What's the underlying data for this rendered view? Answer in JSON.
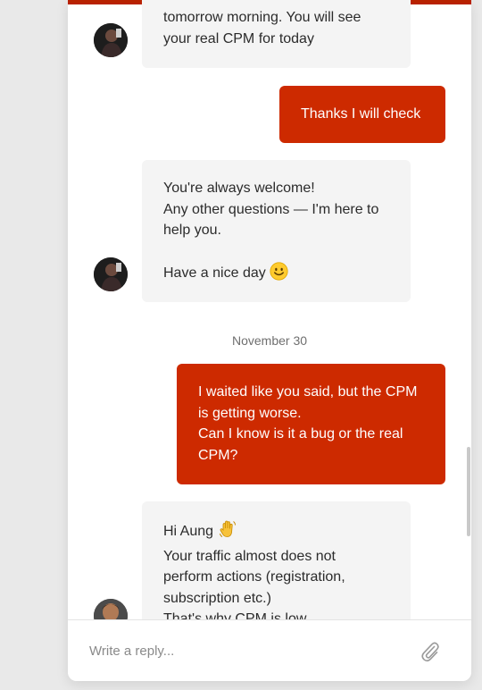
{
  "colors": {
    "accent": "#cd2a00",
    "incoming_bg": "#f4f4f4",
    "topbar": "#b82200"
  },
  "messages": [
    {
      "lines": [
        "tomorrow morning. You will see",
        "your real CPM for today"
      ]
    },
    {
      "lines": [
        "Thanks I will check"
      ]
    },
    {
      "lines": [
        "You're always welcome!",
        "Any other questions — I'm here to",
        "help you.",
        "",
        "Have a nice day"
      ]
    },
    {
      "lines": [
        "I waited like you said, but the CPM",
        "is getting worse.",
        "Can I know is it a bug or the real",
        "CPM?"
      ]
    },
    {
      "lines": [
        "Hi Aung",
        "Your traffic almost does not",
        "perform actions (registration,",
        "subscription etc.)",
        "That's why CPM is low"
      ]
    }
  ],
  "date_separator": "November 30",
  "icons": {
    "smile": "smiling-face-emoji",
    "wave": "waving-hand-emoji",
    "attach": "paperclip-icon"
  },
  "composer": {
    "placeholder": "Write a reply..."
  }
}
